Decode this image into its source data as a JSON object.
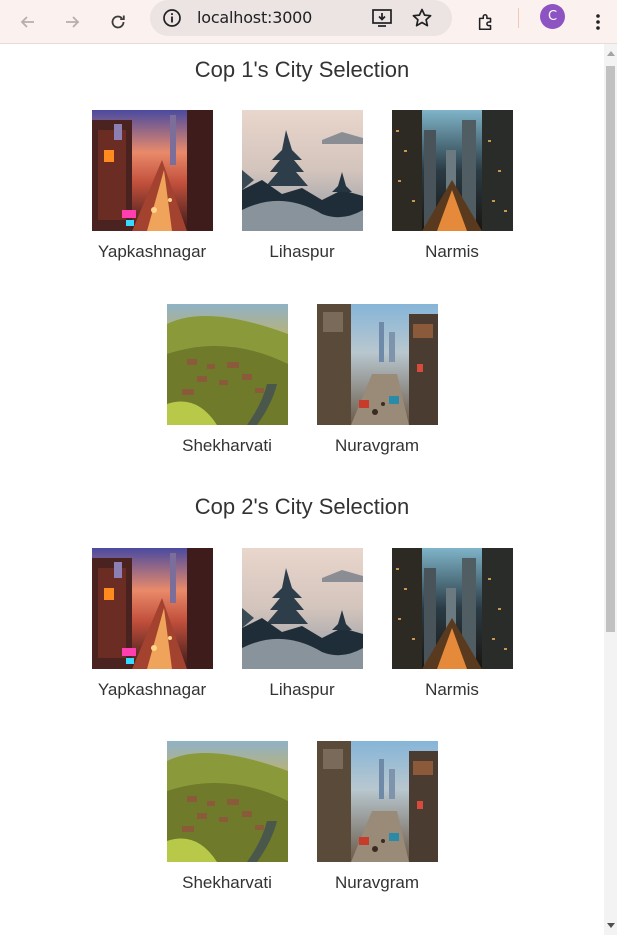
{
  "browser": {
    "url": "localhost:3000",
    "profile_initial": "C",
    "icons": [
      "back-arrow-icon",
      "forward-arrow-icon",
      "reload-icon",
      "site-info-icon",
      "install-app-icon",
      "bookmark-star-icon",
      "extensions-icon",
      "kebab-menu-icon"
    ]
  },
  "sections": [
    {
      "title": "Cop 1's City Selection",
      "cities": [
        {
          "name": "Yapkashnagar",
          "image": "neon-city-street"
        },
        {
          "name": "Lihaspur",
          "image": "misty-pagoda"
        },
        {
          "name": "Narmis",
          "image": "futuristic-skyline"
        },
        {
          "name": "Shekharvati",
          "image": "hillside-village"
        },
        {
          "name": "Nuravgram",
          "image": "busy-city-street"
        }
      ]
    },
    {
      "title": "Cop 2's City Selection",
      "cities": [
        {
          "name": "Yapkashnagar",
          "image": "neon-city-street"
        },
        {
          "name": "Lihaspur",
          "image": "misty-pagoda"
        },
        {
          "name": "Narmis",
          "image": "futuristic-skyline"
        },
        {
          "name": "Shekharvati",
          "image": "hillside-village"
        },
        {
          "name": "Nuravgram",
          "image": "busy-city-street"
        }
      ]
    }
  ],
  "colors": {
    "toolbar_bg": "#fbf1ee",
    "omnibox_bg": "#ece4e2",
    "avatar_bg": "#8e53c2",
    "text": "#333333"
  }
}
